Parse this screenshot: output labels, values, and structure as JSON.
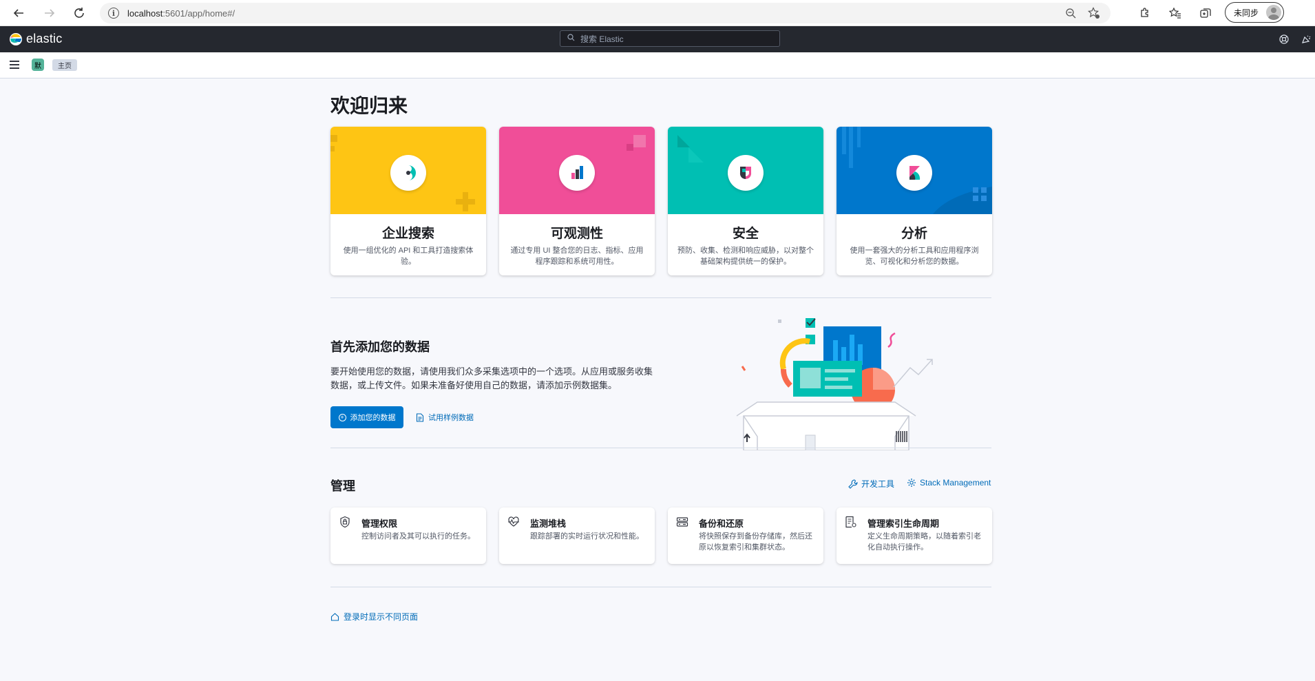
{
  "browser": {
    "url_host": "localhost",
    "url_path": ":5601/app/home#/",
    "sync_label": "未同步"
  },
  "header": {
    "brand": "elastic",
    "search_placeholder": "搜索 Elastic"
  },
  "breadcrumb": {
    "space_initial": "默",
    "home_label": "主页"
  },
  "page": {
    "title": "欢迎归来"
  },
  "solutions": [
    {
      "title": "企业搜索",
      "description": "使用一组优化的 API 和工具打造搜索体验。",
      "color": "#fec514"
    },
    {
      "title": "可观测性",
      "description": "通过专用 UI 整合您的日志、指标、应用程序跟踪和系统可用性。",
      "color": "#f04e98"
    },
    {
      "title": "安全",
      "description": "预防、收集、检测和响应威胁，以对整个基础架构提供统一的保护。",
      "color": "#00bfb3"
    },
    {
      "title": "分析",
      "description": "使用一套强大的分析工具和应用程序浏览、可视化和分析您的数据。",
      "color": "#0077cc"
    }
  ],
  "add_data": {
    "title": "首先添加您的数据",
    "description": "要开始使用您的数据，请使用我们众多采集选项中的一个选项。从应用或服务收集数据，或上传文件。如果未准备好使用自己的数据，请添加示例数据集。",
    "primary_button": "添加您的数据",
    "sample_link": "试用样例数据"
  },
  "management": {
    "title": "管理",
    "dev_tools_link": "开发工具",
    "stack_management_link": "Stack Management",
    "cards": [
      {
        "title": "管理权限",
        "description": "控制访问者及其可以执行的任务。"
      },
      {
        "title": "监测堆栈",
        "description": "跟踪部署的实时运行状况和性能。"
      },
      {
        "title": "备份和还原",
        "description": "将快照保存到备份存储库，然后还原以恢复索引和集群状态。"
      },
      {
        "title": "管理索引生命周期",
        "description": "定义生命周期策略，以随着索引老化自动执行操作。"
      }
    ]
  },
  "footer": {
    "link": "登录时显示不同页面"
  }
}
